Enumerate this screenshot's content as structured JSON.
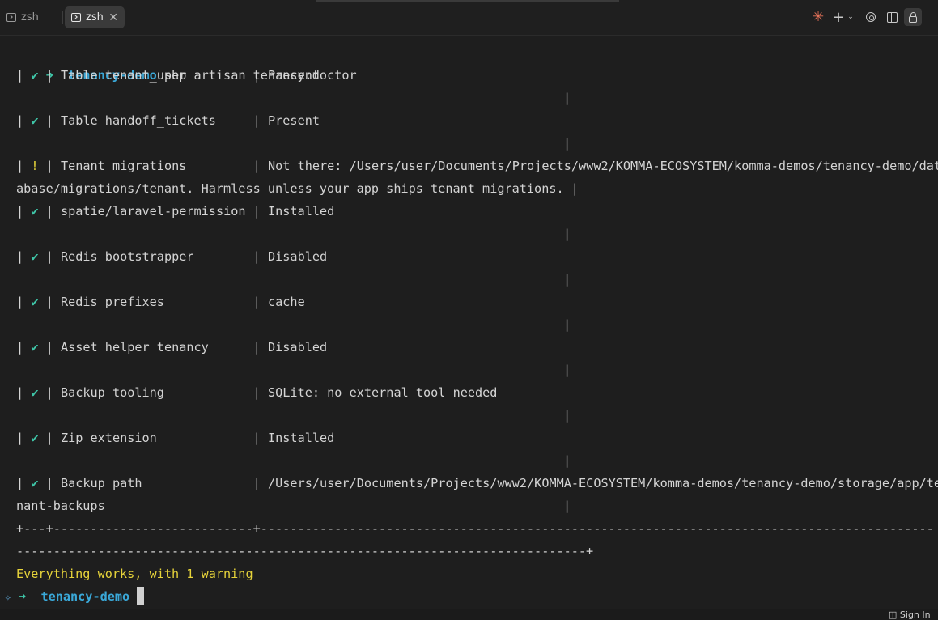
{
  "tabs": [
    {
      "label": "zsh",
      "active": false
    },
    {
      "label": "zsh",
      "active": true
    }
  ],
  "toolbar": {
    "spark_glyph": "✳",
    "plus_glyph": "+",
    "chevron_glyph": "⌄"
  },
  "tab_close_glyph": "✕",
  "prompt": {
    "arrow": "➜",
    "dir": "tenancy-demo",
    "command": " php artisan tenancy:doctor"
  },
  "rows": [
    {
      "status": "✔",
      "level": "ok",
      "check": "Table tenant_user         ",
      "value": "Present",
      "cont": ""
    },
    {
      "status": "✔",
      "level": "ok",
      "check": "Table handoff_tickets     ",
      "value": "Present",
      "cont": ""
    },
    {
      "status": "!",
      "level": "warn",
      "check": "Tenant migrations         ",
      "value": "Not there: /Users/user/Documents/Projects/www2/KOMMA-ECOSYSTEM/komma-demos/tenancy-demo/dat",
      "cont": "abase/migrations/tenant. Harmless unless your app ships tenant migrations. |"
    },
    {
      "status": "✔",
      "level": "ok",
      "check": "spatie/laravel-permission ",
      "value": "Installed",
      "cont": ""
    },
    {
      "status": "✔",
      "level": "ok",
      "check": "Redis bootstrapper        ",
      "value": "Disabled",
      "cont": ""
    },
    {
      "status": "✔",
      "level": "ok",
      "check": "Redis prefixes            ",
      "value": "cache",
      "cont": ""
    },
    {
      "status": "✔",
      "level": "ok",
      "check": "Asset helper tenancy      ",
      "value": "Disabled",
      "cont": ""
    },
    {
      "status": "✔",
      "level": "ok",
      "check": "Backup tooling            ",
      "value": "SQLite: no external tool needed",
      "cont": ""
    },
    {
      "status": "✔",
      "level": "ok",
      "check": "Zip extension             ",
      "value": "Installed",
      "cont": ""
    },
    {
      "status": "✔",
      "level": "ok",
      "check": "Backup path               ",
      "value": "/Users/user/Documents/Projects/www2/KOMMA-ECOSYSTEM/komma-demos/tenancy-demo/storage/app/te",
      "cont": "nant-backups"
    }
  ],
  "table_border_1": "+---+---------------------------+-------------------------------------------------------------------------------------------",
  "table_border_2": "-----------------------------------------------------------------------------+",
  "pipe": "|",
  "summary": "Everything works, with 1 warning",
  "final_prompt": {
    "icon": "✧",
    "arrow": "➜",
    "dir": "tenancy-demo"
  },
  "status_bar": {
    "signin_label": "Sign In"
  },
  "colors": {
    "background": "#1e1e1e",
    "check_green": "#3fc6a8",
    "warn_yellow": "#e6d33a",
    "dir_blue": "#3aa8d8"
  }
}
